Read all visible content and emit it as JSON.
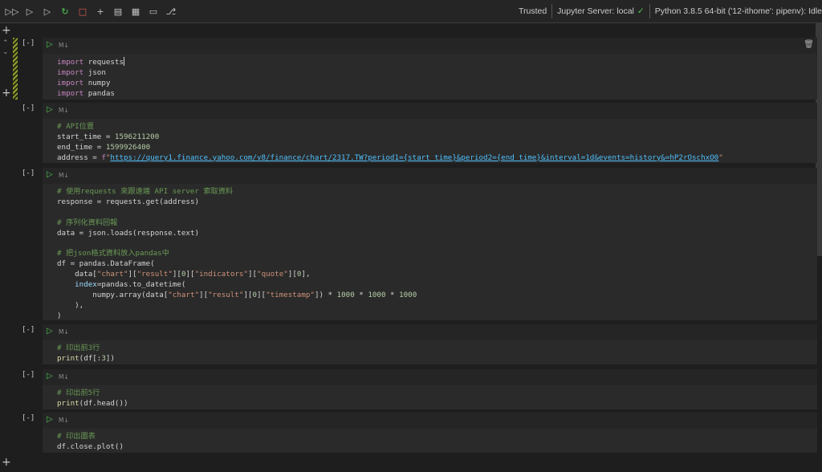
{
  "toolbar": {
    "icons": [
      "run-all-icon",
      "run-above-icon",
      "run-below-icon",
      "restart-icon",
      "interrupt-icon",
      "add-cell-icon",
      "clear-outputs-icon",
      "variables-icon",
      "export-icon",
      "outline-icon"
    ],
    "trusted": "Trusted",
    "server": "Jupyter Server: local",
    "kernel": "Python 3.8.5 64-bit ('12-ithome': pipenv): Idle"
  },
  "cells": [
    {
      "label": "[-]",
      "md": "M↓",
      "lines": [
        "import requests",
        "import json",
        "import numpy",
        "import pandas"
      ]
    },
    {
      "label": "[-]",
      "md": "M↓",
      "lines": [
        "# API位置",
        "start_time = 1596211200",
        "end_time = 1599926400",
        "address = f\"https://query1.finance.yahoo.com/v8/finance/chart/2317.TW?period1={start_time}&period2={end_time}&interval=1d&events=history&=hP2rOschxO0\""
      ]
    },
    {
      "label": "[-]",
      "md": "M↓",
      "lines": [
        "# 使用requests 來跟遠端 API server 索取資料",
        "response = requests.get(address)",
        "",
        "# 序列化資料回報",
        "data = json.loads(response.text)",
        "",
        "# 把json格式資料放入pandas中",
        "df = pandas.DataFrame(",
        "    data[\"chart\"][\"result\"][0][\"indicators\"][\"quote\"][0],",
        "    index=pandas.to_datetime(",
        "        numpy.array(data[\"chart\"][\"result\"][0][\"timestamp\"]) * 1000 * 1000 * 1000",
        "    ),",
        ")"
      ]
    },
    {
      "label": "[-]",
      "md": "M↓",
      "lines": [
        "# 印出前3行",
        "print(df[:3])"
      ]
    },
    {
      "label": "[-]",
      "md": "M↓",
      "lines": [
        "# 印出前5行",
        "print(df.head())"
      ]
    },
    {
      "label": "[-]",
      "md": "M↓",
      "lines": [
        "# 印出圖表",
        "df.close.plot()"
      ]
    }
  ]
}
